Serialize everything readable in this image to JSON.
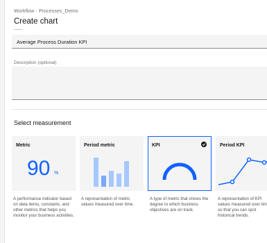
{
  "breadcrumb": "Workflow · Processes_Demo",
  "page": {
    "title": "Create chart"
  },
  "form": {
    "name_value": "Average Process Duration KPI",
    "description_label": "Description (optional)",
    "description_value": ""
  },
  "section": {
    "title": "Select measurement"
  },
  "tiles": [
    {
      "title": "Metric",
      "value": "90",
      "unit": "%",
      "description": "A performance indicator based on data items, constants, and other metrics that helps you monitor your business activities.",
      "selected": false
    },
    {
      "title": "Period metric",
      "description": "A representation of metric values measured over time.",
      "selected": false
    },
    {
      "title": "KPI",
      "description": "A type of metric that shows the degree to which business objectives are on track.",
      "selected": true
    },
    {
      "title": "Period KPI",
      "description": "A representation of KPI values measured over time so that you can spot historical trends.",
      "selected": false
    }
  ],
  "colors": {
    "accent": "#0f62fe",
    "accent_light": "#a6c8ff",
    "tile_bg": "#f4f4f4"
  },
  "icons": {
    "selected": "checkmark-filled-icon"
  }
}
